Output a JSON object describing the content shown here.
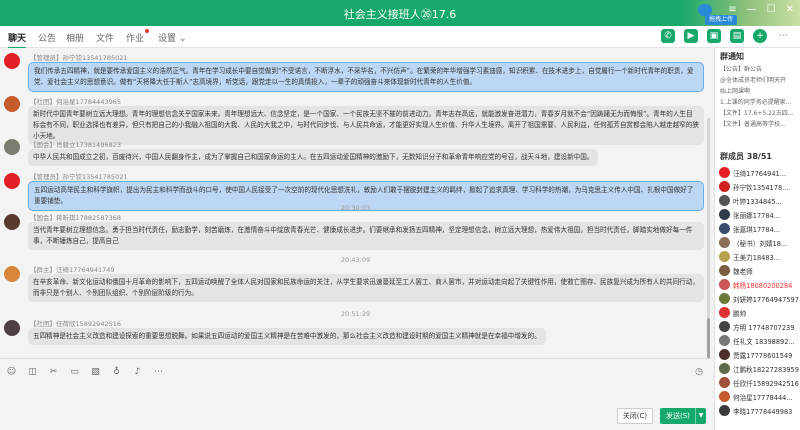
{
  "window": {
    "title": "社会主义接班人㉖17.6",
    "upload_label": "拖拽上传"
  },
  "tabs": [
    {
      "label": "聊天",
      "active": true
    },
    {
      "label": "公告"
    },
    {
      "label": "相册"
    },
    {
      "label": "文件"
    },
    {
      "label": "作业",
      "dot": true
    },
    {
      "label": "设置 ⌄"
    }
  ],
  "messages": [
    {
      "sender": "【管理员】孙宁钦13541785021",
      "text": "我们传承五四精神，就是要传承爱国主义的浩然正气。青年在学习成长中要自觉做到“不受诺言，不断浮水，不采华名，不兴仿声”。在繁荣的年华增强学习素迪感，知识积累、在技术进步上，自觉履行一个新时代青年的职责，爱党、爱社会主义的思想意识。做有“天将降大任于斯人”志高境界，听党话，跟党走以一生的真情投入，一辈子的顽强奋斗来体现新时代青年的人生价值。",
      "blue": true
    },
    {
      "sender": "【社团】何治星17784443965",
      "text": "新时代中国青年要树立远大理想。青年的理想信念关乎国家未来。青年理想远大、信念坚定，是一个国家、一个民族无坚不摧的前进动力。青年志存高远，就能激发奋进潜力，青春岁月就不会“因踌躇无为而悔恨”。青年的人生目标会有不同，职业选择也有差异，但只有把自己的小我融入祖国的大我、人民的大我之中，与时代同步伐、与人民共命运，才能更好实现人生价值、升华人生境界。离开了祖国需要、人民利益，任何孤芳自赏都会陷入越走越窄的狭小天地。"
    },
    {
      "sender": "【国会】肖骏立17381496823",
      "text": "中华人民共和国成立之初，百废待兴，中国人民翻身作主，成为了掌握自己和国家命运的主人。在五四运动爱国精神的激励下，无数知识分子和革命青年响应党的号召，战天斗地，建设新中国。",
      "short": true
    },
    {
      "sender": "【管理员】孙宁钦13541785021",
      "text": "五四运动高举民主和科学旗帜，提出为民主和科学而战斗的口号，使中国人民接受了一次空前的现代化思想洗礼，敦励人们敢于摆脱封建主义的羁绊，掀起了追求真理、学习科学的热潮，为马克思主义传入中国、扎根中国做好了重要铺垫。",
      "blue": true
    },
    {
      "sender": "【国会】蒋昕琪17882587368",
      "text": "当代青年要树立理想信念。勇于担当时代责任，励志勤学，刻苦磨炼，在激情奋斗中绽放青春光芒、健康成长进步。们要继承和发扬五四精神，坚定理想信念，树立远大理想，热爱伟大祖国，担当时代责任，脚踏实地做好每一件事，不断锤炼自己，提高自己"
    },
    {
      "sender": "【群主】汪绮17764941749",
      "text": "在辛亥革命、新文化运动和俄国十月革命的影响下，五四运动唤醒了全体人民对国家和民族命运的关注，从学生要求迅速蔓延至工人罢工、商人罢市，并对运动走向起了关键性作用，使救亡图存、民族复兴成为所有人的共同行动，而非只是个别人、个别团队组织、个别阶层阶级的行为。"
    },
    {
      "sender": "【社团】任荷欣15892942516",
      "text": "五四精神是社会主义改造和建设探索的重要思想脱舞。如果说五四运动的爱国主义精神是在苦难中激发的，那么社会主义改造和建设时期的爱国主义精神就是在幸福中增发的。"
    }
  ],
  "times": [
    "20:30:03",
    "20:43:09",
    "20:51:29"
  ],
  "notice": {
    "heading": "群通知",
    "lines": [
      "【公告】群公告",
      "@全体成员老师们明天开",
      "始上网课啊",
      "1.上课的同学务必提醒家...",
      "【文件】17.6+5.22五四...",
      "【文件】普通高等学校..."
    ]
  },
  "members_header": "群成员 38/51",
  "members": [
    {
      "name": "汪绮17764941..."
    },
    {
      "name": "孙宁钦1354178..."
    },
    {
      "name": "叶婷1334845..."
    },
    {
      "name": "张丽娜17784..."
    },
    {
      "name": "张嘉琪17784..."
    },
    {
      "name": "（秘书）刘婧18..."
    },
    {
      "name": "王美力18483..."
    },
    {
      "name": "魏老师"
    },
    {
      "name": "韩杨18080200284",
      "red": true
    },
    {
      "name": "刘妍婷17764947597"
    },
    {
      "name": "鹏帅"
    },
    {
      "name": "方明 17748707239"
    },
    {
      "name": "任礼文 18398892..."
    },
    {
      "name": "贾露17778601549"
    },
    {
      "name": "江鹏秋18227283959"
    },
    {
      "name": "任欣仟15892942516"
    },
    {
      "name": "何治星17778444..."
    },
    {
      "name": "李晓17778449983"
    }
  ],
  "buttons": {
    "close": "关闭(C)",
    "send": "发送(S)"
  }
}
